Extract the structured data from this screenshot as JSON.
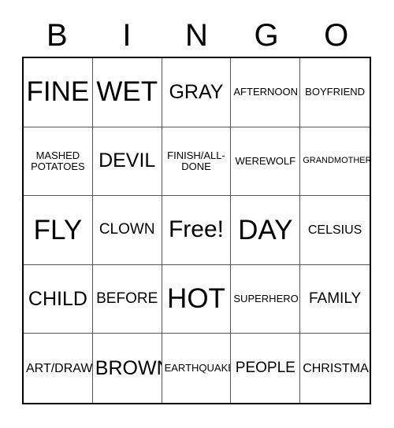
{
  "header": {
    "letters": [
      "B",
      "I",
      "N",
      "G",
      "O"
    ]
  },
  "grid": {
    "rows": [
      [
        {
          "label": "FINE",
          "size": "s-xxl"
        },
        {
          "label": "WET",
          "size": "s-xxl"
        },
        {
          "label": "GRAY",
          "size": "s-l"
        },
        {
          "label": "AFTERNOON",
          "size": "s-xs"
        },
        {
          "label": "BOYFRIEND",
          "size": "s-xs"
        }
      ],
      [
        {
          "label": "MASHED\nPOTATOES",
          "size": "s-xs"
        },
        {
          "label": "DEVIL",
          "size": "s-l"
        },
        {
          "label": "FINISH/ALL-\nDONE",
          "size": "s-xs"
        },
        {
          "label": "WEREWOLF",
          "size": "s-xs"
        },
        {
          "label": "GRANDMOTHER",
          "size": "s-xxs"
        }
      ],
      [
        {
          "label": "FLY",
          "size": "s-xxl"
        },
        {
          "label": "CLOWN",
          "size": "s-m"
        },
        {
          "label": "Free!",
          "size": "s-xl"
        },
        {
          "label": "DAY",
          "size": "s-xxl"
        },
        {
          "label": "CELSIUS",
          "size": "s-s"
        }
      ],
      [
        {
          "label": "CHILD",
          "size": "s-l"
        },
        {
          "label": "BEFORE",
          "size": "s-m"
        },
        {
          "label": "HOT",
          "size": "s-xxl"
        },
        {
          "label": "SUPERHERO",
          "size": "s-xs"
        },
        {
          "label": "FAMILY",
          "size": "s-m"
        }
      ],
      [
        {
          "label": "ART/DRAW",
          "size": "s-s"
        },
        {
          "label": "BROWN",
          "size": "s-l"
        },
        {
          "label": "EARTHQUAKE",
          "size": "s-xs"
        },
        {
          "label": "PEOPLE",
          "size": "s-m"
        },
        {
          "label": "CHRISTMAS",
          "size": "s-s"
        }
      ]
    ]
  },
  "colors": {
    "background": "#ffffff",
    "text": "#000000",
    "grid_border": "#000000",
    "cell_border": "#555555"
  }
}
